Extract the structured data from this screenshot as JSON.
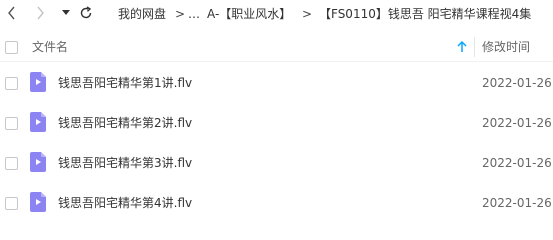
{
  "nav": {
    "back_icon": "chevron-left-icon",
    "forward_icon": "chevron-right-icon",
    "history_icon": "caret-down-icon",
    "refresh_icon": "refresh-icon",
    "breadcrumb": [
      "我的网盘",
      "A-【职业风水】",
      "【FS0110】钱思吾 阳宅精华课程视4集"
    ],
    "separator": ">",
    "ellipsis": "…"
  },
  "table": {
    "header": {
      "name": "文件名",
      "modified": "修改时间",
      "sort_icon": "arrow-up-icon"
    },
    "rows": [
      {
        "name": "钱思吾阳宅精华第1讲.flv",
        "modified": "2022-01-26",
        "icon": "video-file-icon"
      },
      {
        "name": "钱思吾阳宅精华第2讲.flv",
        "modified": "2022-01-26",
        "icon": "video-file-icon"
      },
      {
        "name": "钱思吾阳宅精华第3讲.flv",
        "modified": "2022-01-26",
        "icon": "video-file-icon"
      },
      {
        "name": "钱思吾阳宅精华第4讲.flv",
        "modified": "2022-01-26",
        "icon": "video-file-icon"
      }
    ]
  },
  "colors": {
    "accent": "#06a7ff",
    "file_icon": "#8c84f2",
    "file_icon_fold": "#b7b1f7",
    "text": "#333333",
    "muted": "#666666"
  }
}
